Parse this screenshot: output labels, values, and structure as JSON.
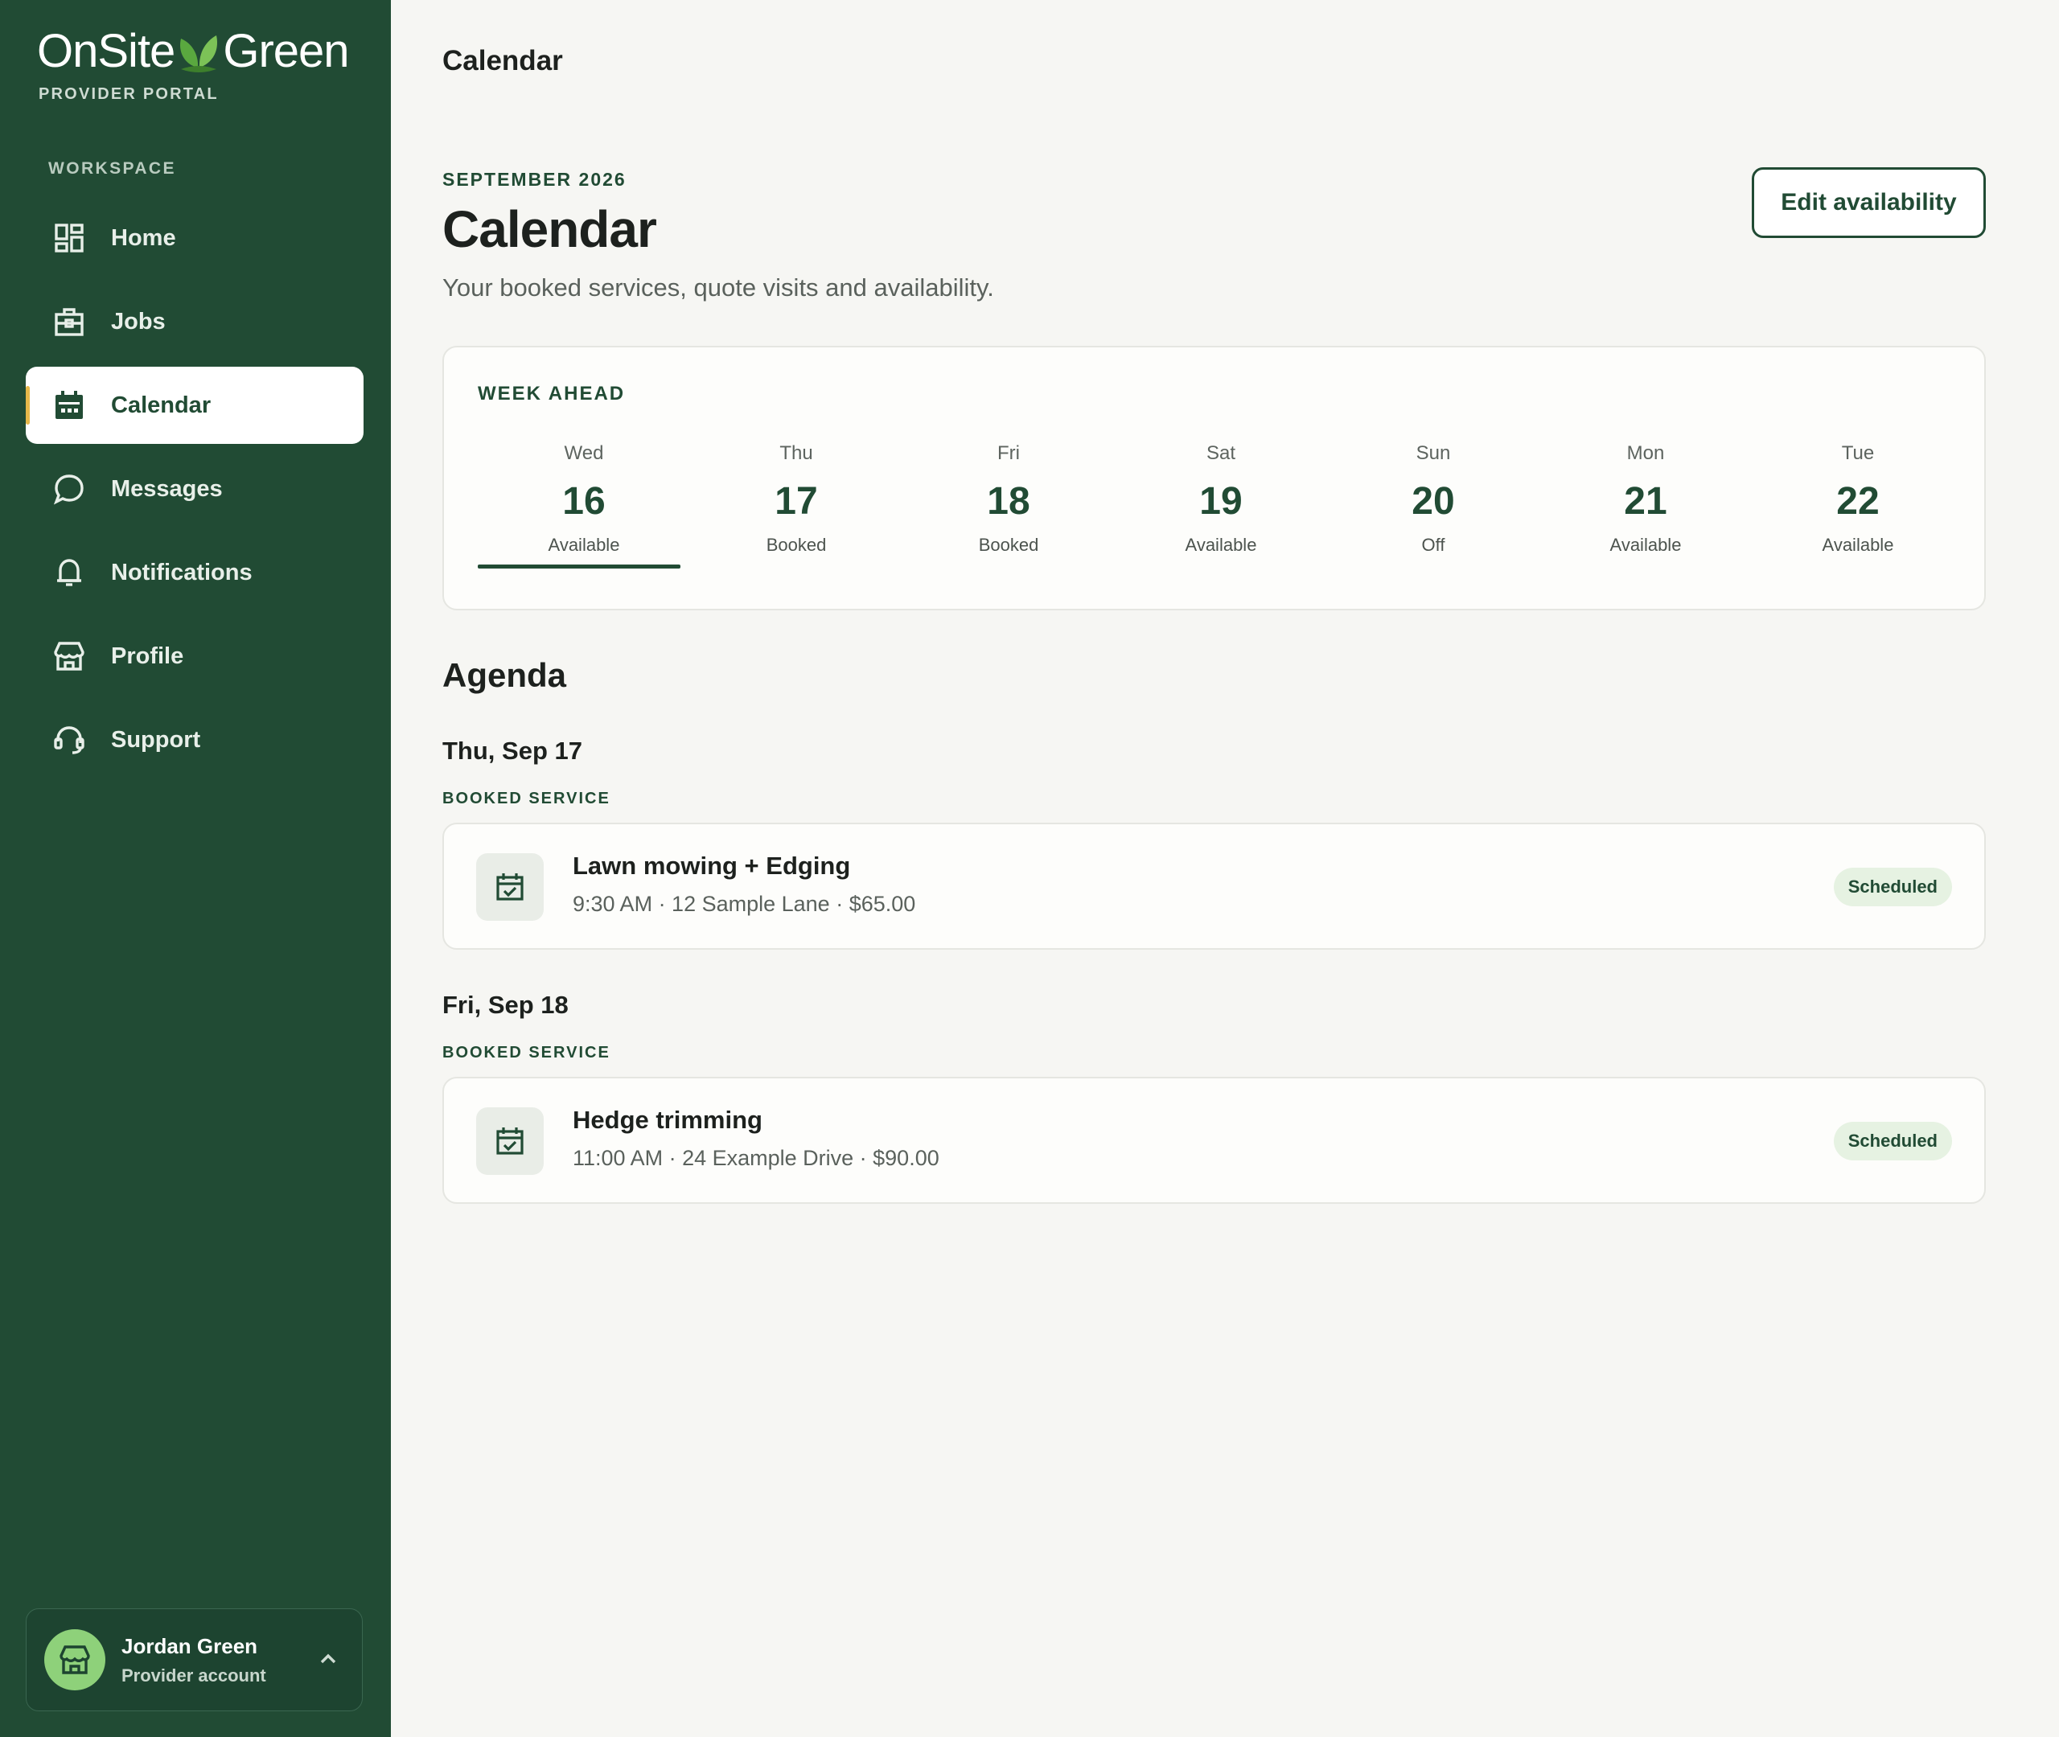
{
  "brand": {
    "name_left": "OnSite",
    "name_right": "Green",
    "tagline": "PROVIDER PORTAL"
  },
  "sidebar": {
    "section_label": "WORKSPACE",
    "items": [
      {
        "label": "Home",
        "icon": "dashboard-icon"
      },
      {
        "label": "Jobs",
        "icon": "toolbox-icon"
      },
      {
        "label": "Calendar",
        "icon": "calendar-icon",
        "active": true
      },
      {
        "label": "Messages",
        "icon": "chat-bubble-icon"
      },
      {
        "label": "Notifications",
        "icon": "bell-icon"
      },
      {
        "label": "Profile",
        "icon": "storefront-icon"
      },
      {
        "label": "Support",
        "icon": "headset-icon"
      }
    ],
    "account": {
      "name": "Jordan Green",
      "role": "Provider account"
    }
  },
  "topbar": {
    "title": "Calendar"
  },
  "header": {
    "eyebrow": "SEPTEMBER 2026",
    "title": "Calendar",
    "subtitle": "Your booked services, quote visits and availability.",
    "edit_button": "Edit availability"
  },
  "week": {
    "label": "WEEK AHEAD",
    "days": [
      {
        "dow": "Wed",
        "num": "16",
        "status": "Available",
        "selected": true
      },
      {
        "dow": "Thu",
        "num": "17",
        "status": "Booked"
      },
      {
        "dow": "Fri",
        "num": "18",
        "status": "Booked"
      },
      {
        "dow": "Sat",
        "num": "19",
        "status": "Available"
      },
      {
        "dow": "Sun",
        "num": "20",
        "status": "Off"
      },
      {
        "dow": "Mon",
        "num": "21",
        "status": "Available"
      },
      {
        "dow": "Tue",
        "num": "22",
        "status": "Available"
      }
    ]
  },
  "agenda": {
    "title": "Agenda",
    "groups": [
      {
        "date": "Thu, Sep 17",
        "kind": "BOOKED SERVICE",
        "item": {
          "title": "Lawn mowing + Edging",
          "meta": "9:30 AM · 12 Sample Lane · $65.00",
          "status": "Scheduled"
        }
      },
      {
        "date": "Fri, Sep 18",
        "kind": "BOOKED SERVICE",
        "item": {
          "title": "Hedge trimming",
          "meta": "11:00 AM · 24 Example Drive · $90.00",
          "status": "Scheduled"
        }
      }
    ]
  },
  "colors": {
    "sidebar": "#214b34",
    "accent": "#214b34",
    "indicator": "#e7b84a",
    "avatar": "#8ed17a",
    "badge_bg": "#e6f2e2"
  }
}
